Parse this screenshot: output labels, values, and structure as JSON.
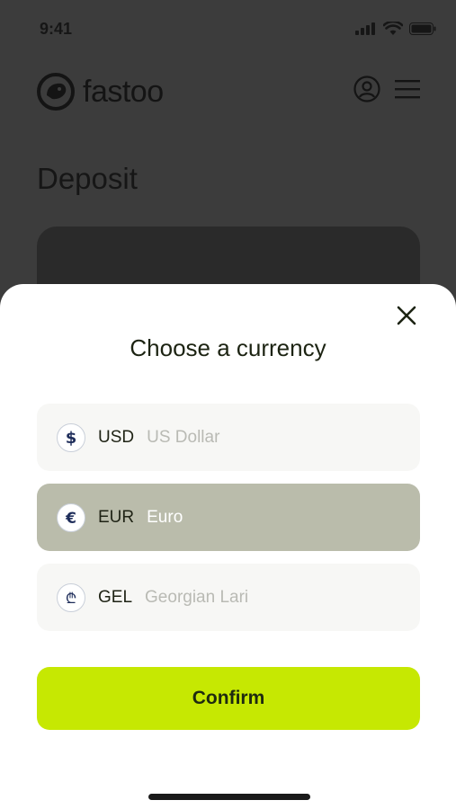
{
  "status_bar": {
    "time": "9:41"
  },
  "header": {
    "logo_text": "fastoo"
  },
  "page": {
    "title": "Deposit"
  },
  "sheet": {
    "title": "Choose a currency",
    "currencies": [
      {
        "code": "USD",
        "name": "US Dollar",
        "icon": "dollar-icon",
        "selected": false
      },
      {
        "code": "EUR",
        "name": "Euro",
        "icon": "euro-icon",
        "selected": true
      },
      {
        "code": "GEL",
        "name": "Georgian Lari",
        "icon": "lari-icon",
        "selected": false
      }
    ],
    "confirm_label": "Confirm"
  },
  "colors": {
    "accent": "#c6e802",
    "selected_row": "#babcab",
    "overlay": "#3c3c3c"
  }
}
